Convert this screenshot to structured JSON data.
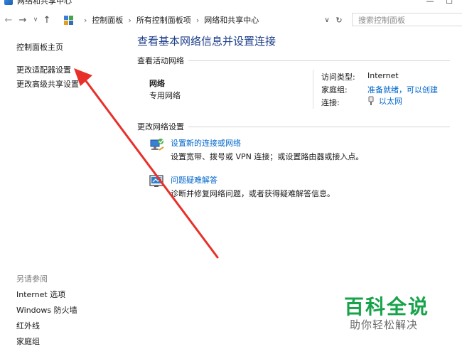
{
  "window": {
    "title": "网络和共享中心",
    "minimize_icon": "minimize-icon",
    "maximize_icon": "maximize-icon"
  },
  "navigation": {
    "back_icon": "arrow-left-icon",
    "forward_icon": "arrow-right-icon",
    "recent_icon": "chevron-down-icon",
    "up_icon": "arrow-up-icon",
    "breadcrumb": [
      "控制面板",
      "所有控制面板项",
      "网络和共享中心"
    ],
    "dropdown_icon": "chevron-down-icon",
    "refresh_icon": "refresh-icon",
    "search_placeholder": "搜索控制面板"
  },
  "sidebar": {
    "items": [
      {
        "label": "控制面板主页"
      },
      {
        "label": "更改适配器设置"
      },
      {
        "label": "更改高级共享设置"
      }
    ],
    "see_also_title": "另请参阅",
    "see_also": [
      {
        "label": "Internet 选项"
      },
      {
        "label": "Windows 防火墙"
      },
      {
        "label": "红外线"
      },
      {
        "label": "家庭组"
      }
    ]
  },
  "main": {
    "title": "查看基本网络信息并设置连接",
    "active_networks_heading": "查看活动网络",
    "network": {
      "name": "网络",
      "type": "专用网络",
      "access_type_label": "访问类型:",
      "access_type_value": "Internet",
      "homegroup_label": "家庭组:",
      "homegroup_value": "准备就绪，可以创建",
      "connection_label": "连接:",
      "connection_value": "以太网"
    },
    "change_settings_heading": "更改网络设置",
    "tasks": [
      {
        "link": "设置新的连接或网络",
        "description": "设置宽带、拨号或 VPN 连接；或设置路由器或接入点。",
        "icon": "network-setup-icon"
      },
      {
        "link": "问题疑难解答",
        "description": "诊断并修复网络问题，或者获得疑难解答信息。",
        "icon": "troubleshoot-icon"
      }
    ]
  },
  "watermark": {
    "title": "百科全说",
    "subtitle": "助你轻松解决"
  },
  "colors": {
    "title_blue": "#1e3f8a",
    "link_blue": "#0066cc",
    "annotation_red": "#e8302a",
    "watermark_green": "#17a34a"
  }
}
